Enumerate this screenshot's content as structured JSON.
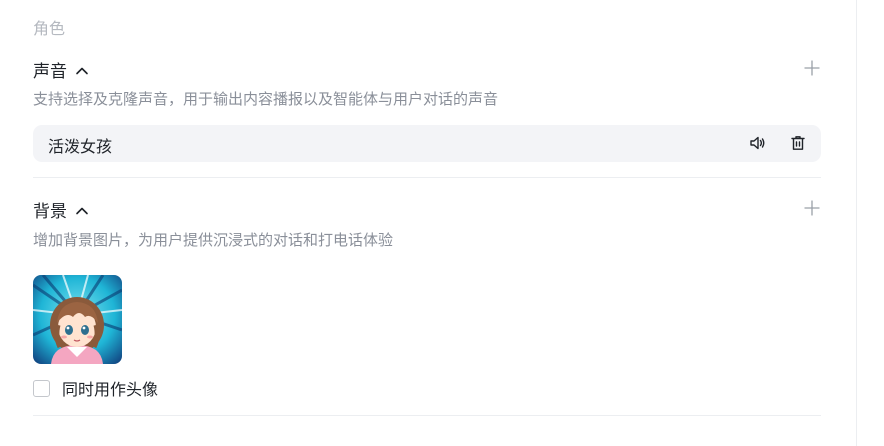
{
  "section": {
    "label": "角色"
  },
  "voice": {
    "title": "声音",
    "description": "支持选择及克隆声音，用于输出内容播报以及智能体与用户对话的声音",
    "selected": {
      "name": "活泼女孩"
    },
    "icons": {
      "expand": "chevron-up-icon",
      "add": "plus-icon",
      "play": "speaker-icon",
      "delete": "trash-icon"
    }
  },
  "background": {
    "title": "背景",
    "description": "增加背景图片，为用户提供沉浸式的对话和打电话体验",
    "image": {
      "alt": "anime-girl-avatar"
    },
    "checkbox": {
      "label": "同时用作头像",
      "checked": false
    },
    "icons": {
      "expand": "chevron-up-icon",
      "add": "plus-icon"
    }
  },
  "colors": {
    "text": "#1f2329",
    "muted": "#8a8f99",
    "header": "#b5b9c0",
    "card_bg": "#f3f4f7"
  }
}
